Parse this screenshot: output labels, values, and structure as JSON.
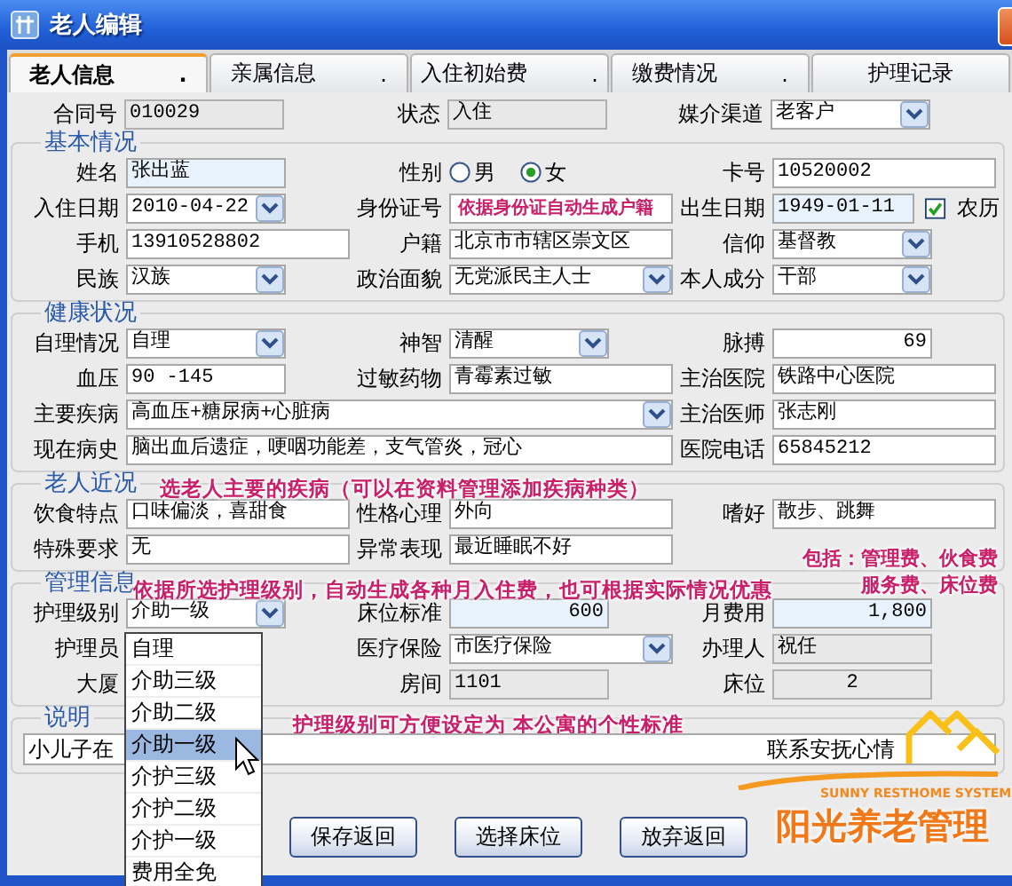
{
  "window": {
    "title": "老人编辑"
  },
  "tabs": [
    {
      "label": "老人信息",
      "mark": ".",
      "selected": true
    },
    {
      "label": "亲属信息",
      "mark": ".",
      "selected": false
    },
    {
      "label": "入住初始费",
      "mark": ".",
      "selected": false
    },
    {
      "label": "缴费情况",
      "mark": ".",
      "selected": false
    },
    {
      "label": "护理记录",
      "selected": false
    }
  ],
  "header_fields": [
    [
      {
        "label": "合同号",
        "kind": "readonly",
        "value": "010029"
      },
      {
        "label": "状态",
        "kind": "readonly",
        "value": "入住"
      },
      {
        "label": "媒介渠道",
        "kind": "combo",
        "value": "老客户"
      }
    ]
  ],
  "sections": [
    {
      "title": "基本情况",
      "rows": [
        [
          {
            "label": "姓名",
            "kind": "highlight",
            "value": "张出蓝"
          },
          {
            "label": "性别",
            "kind": "radio",
            "options": [
              {
                "label": "男",
                "selected": false
              },
              {
                "label": "女",
                "selected": true
              }
            ]
          },
          {
            "label": "卡号",
            "kind": "text",
            "value": "10520002"
          }
        ],
        [
          {
            "label": "入住日期",
            "kind": "combo",
            "value": "2010-04-22"
          },
          {
            "label": "身份证号",
            "kind": "text"
          },
          {
            "label": "出生日期",
            "kind": "highlight",
            "value": "1949-01-11",
            "check": {
              "label": "农历",
              "checked": true
            }
          }
        ],
        [
          {
            "label": "手机",
            "kind": "text",
            "value": "13910528802"
          },
          {
            "label": "户籍",
            "kind": "text",
            "value": "北京市市辖区崇文区"
          },
          {
            "label": "信仰",
            "kind": "combo",
            "value": "基督教"
          }
        ],
        [
          {
            "label": "民族",
            "kind": "combo",
            "value": "汉族"
          },
          {
            "label": "政治面貌",
            "kind": "combo",
            "value": "无党派民主人士"
          },
          {
            "label": "本人成分",
            "kind": "combo",
            "value": "干部"
          }
        ]
      ]
    },
    {
      "title": "健康状况",
      "rows": [
        [
          {
            "label": "自理情况",
            "kind": "combo",
            "value": "自理"
          },
          {
            "label": "神智",
            "kind": "combo",
            "value": "清醒"
          },
          {
            "label": "脉搏",
            "kind": "text",
            "value": "69"
          }
        ],
        [
          {
            "label": "血压",
            "kind": "text",
            "value": "90 -145"
          },
          {
            "label": "过敏药物",
            "kind": "text",
            "value": "青霉素过敏"
          },
          {
            "label": "主治医院",
            "kind": "text",
            "value": "铁路中心医院"
          }
        ],
        [
          {
            "label": "主要疾病",
            "kind": "combo",
            "value": "高血压+糖尿病+心脏病"
          },
          {
            "label": "主治医师",
            "kind": "text",
            "value": "张志刚"
          }
        ],
        [
          {
            "label": "现在病史",
            "kind": "text",
            "value": "脑出血后遗症，哽咽功能差，支气管炎，冠心"
          },
          {
            "label": "医院电话",
            "kind": "text",
            "value": "65845212"
          }
        ]
      ]
    },
    {
      "title": "老人近况",
      "rows": [
        [
          {
            "label": "饮食特点",
            "kind": "text",
            "value": "口味偏淡，喜甜食"
          },
          {
            "label": "性格心理",
            "kind": "text",
            "value": "外向"
          },
          {
            "label": "嗜好",
            "kind": "text",
            "value": "散步、跳舞"
          }
        ],
        [
          {
            "label": "特殊要求",
            "kind": "text",
            "value": "无"
          },
          {
            "label": "异常表现",
            "kind": "text",
            "value": "最近睡眠不好"
          }
        ]
      ]
    },
    {
      "title": "管理信息",
      "rows": [
        [
          {
            "label": "护理级别",
            "kind": "combo",
            "value": "介助一级"
          },
          {
            "label": "床位标准",
            "kind": "highlight",
            "value": "600"
          },
          {
            "label": "月费用",
            "kind": "highlight",
            "value": "1,800"
          }
        ],
        [
          {
            "label": "护理员",
            "kind": "hidden"
          },
          {
            "label": "医疗保险",
            "kind": "combo",
            "value": "市医疗保险"
          },
          {
            "label": "办理人",
            "kind": "readonly",
            "value": "祝任"
          }
        ],
        [
          {
            "label": "大厦",
            "kind": "hidden"
          },
          {
            "label": "房间",
            "kind": "readonly",
            "value": "1101"
          },
          {
            "label": "床位",
            "kind": "readonly",
            "value": "2"
          }
        ]
      ]
    },
    {
      "title": "说明",
      "note": {
        "visible_start": "小儿子在",
        "visible_end": "联系安抚心情"
      }
    }
  ],
  "care_level_dropdown": [
    {
      "label": "自理",
      "selected": false
    },
    {
      "label": "介助三级",
      "selected": false
    },
    {
      "label": "介助二级",
      "selected": false
    },
    {
      "label": "介助一级",
      "selected": true
    },
    {
      "label": "介护三级",
      "selected": false
    },
    {
      "label": "介护二级",
      "selected": false
    },
    {
      "label": "介护一级",
      "selected": false
    },
    {
      "label": "费用全免",
      "selected": false
    }
  ],
  "buttons": [
    "保存返回",
    "选择床位",
    "放弃返回"
  ],
  "annotations": [
    {
      "lines": [
        "依据身份证自动生成户籍"
      ]
    },
    {
      "lines": [
        "选老人主要的疾病（可以在资料管理添加疾病种类）"
      ]
    },
    {
      "lines": [
        "依据所选护理级别，自动生成各种月入住费，也可根据实际情况优惠"
      ]
    },
    {
      "lines": [
        "包括：管理费、伙食费",
        "服务费、床位费"
      ]
    },
    {
      "lines": [
        "护理级别可方便设定为 本公寓的个性标准"
      ]
    }
  ],
  "logo": {
    "tagline": "SUNNY RESTHOME SYSTEM",
    "name": "阳光养老管理"
  }
}
